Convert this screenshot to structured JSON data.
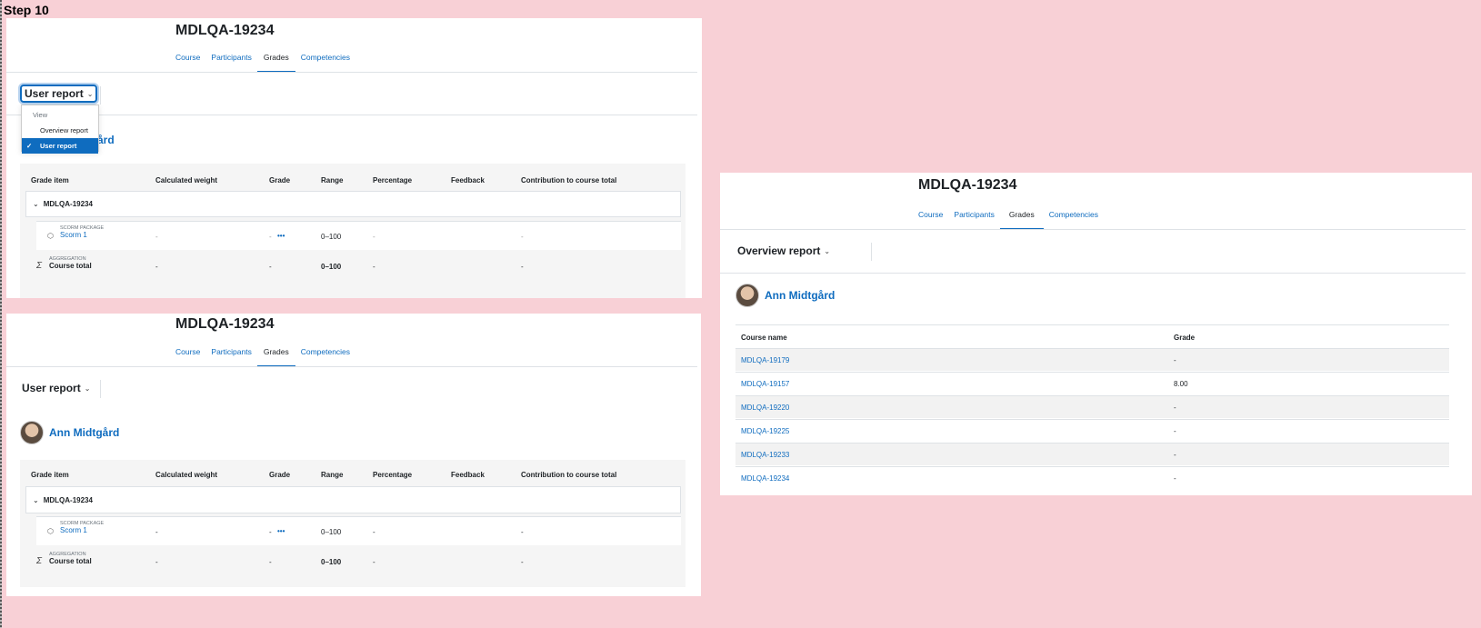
{
  "step_label": "Step 10",
  "course_title": "MDLQA-19234",
  "tabs": [
    "Course",
    "Participants",
    "Grades",
    "Competencies"
  ],
  "active_tab": "Grades",
  "user_report_label": "User report",
  "overview_report_label": "Overview report",
  "dropdown": {
    "heading": "View",
    "items": [
      "Overview report",
      "User report"
    ],
    "selected": "User report"
  },
  "user_name": "Ann Midtgård",
  "user_name_partial": "ård",
  "grade_table": {
    "headers": [
      "Grade item",
      "Calculated weight",
      "Grade",
      "Range",
      "Percentage",
      "Feedback",
      "Contribution to course total"
    ],
    "category": "MDLQA-19234",
    "rows": [
      {
        "type": "SCORM PACKAGE",
        "name": "Scorm 1",
        "weight": "-",
        "grade": "-",
        "range": "0–100",
        "percentage": "-",
        "feedback": "",
        "contribution": "-",
        "icon": "package-icon"
      },
      {
        "type": "AGGREGATION",
        "name": "Course total",
        "weight": "-",
        "grade": "-",
        "range": "0–100",
        "percentage": "-",
        "feedback": "",
        "contribution": "-",
        "icon": "sigma-icon"
      }
    ],
    "actions_glyph": "•••"
  },
  "overview_table": {
    "headers": [
      "Course name",
      "Grade"
    ],
    "rows": [
      {
        "course": "MDLQA-19179",
        "grade": "-"
      },
      {
        "course": "MDLQA-19157",
        "grade": "8.00"
      },
      {
        "course": "MDLQA-19220",
        "grade": "-"
      },
      {
        "course": "MDLQA-19225",
        "grade": "-"
      },
      {
        "course": "MDLQA-19233",
        "grade": "-"
      },
      {
        "course": "MDLQA-19234",
        "grade": "-"
      }
    ]
  },
  "colors": {
    "background": "#f8d0d6",
    "link": "#0f6cbf",
    "selected": "#0f6cbf"
  }
}
